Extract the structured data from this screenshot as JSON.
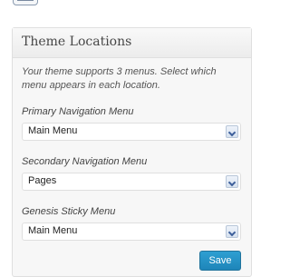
{
  "panel": {
    "title": "Theme Locations",
    "description": "Your theme supports 3 menus. Select which menu appears in each location."
  },
  "locations": [
    {
      "label": "Primary Navigation Menu",
      "selected": "Main Menu"
    },
    {
      "label": "Secondary Navigation Menu",
      "selected": "Pages"
    },
    {
      "label": "Genesis Sticky Menu",
      "selected": "Main Menu"
    }
  ],
  "actions": {
    "save_label": "Save"
  },
  "icons": {
    "dropdown": "chevron-down-icon",
    "top_control": "screen-options-icon"
  },
  "colors": {
    "accent": "#2e9fd2",
    "panel_bg": "#f7f7f7",
    "border": "#dfdfdf"
  }
}
